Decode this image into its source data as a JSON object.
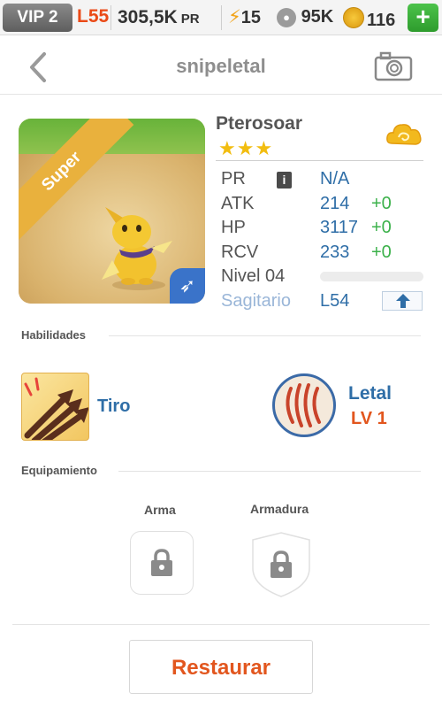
{
  "status_bar": {
    "vip": "VIP 2",
    "level": "L55",
    "power_value": "305,5K",
    "power_unit": "PR",
    "energy": "15",
    "paws": "95K",
    "coins": "116",
    "add": "+"
  },
  "header": {
    "title": "snipeletal"
  },
  "pet": {
    "rarity": "Super",
    "name": "Pterosoar",
    "stars": "★★★",
    "stats": {
      "pr_label": "PR",
      "pr_info": "i",
      "pr_value": "N/A",
      "atk_label": "ATK",
      "atk_value": "214",
      "atk_bonus": "+0",
      "hp_label": "HP",
      "hp_value": "3117",
      "hp_bonus": "+0",
      "rcv_label": "RCV",
      "rcv_value": "233",
      "rcv_bonus": "+0",
      "level_label": "Nivel 04",
      "xp_progress": 0,
      "class_label": "Sagitario",
      "class_level": "L54"
    }
  },
  "skills": {
    "section_title": "Habilidades",
    "skill1_name": "Tiro",
    "skill2_name": "Letal",
    "skill2_level": "LV 1"
  },
  "equipment": {
    "section_title": "Equipamiento",
    "weapon_label": "Arma",
    "armor_label": "Armadura"
  },
  "actions": {
    "restore_label": "Restaurar"
  },
  "colors": {
    "accent_blue": "#2f6ea7",
    "accent_orange": "#e2561e",
    "bonus_green": "#3bb14a",
    "star_gold": "#f2bd10"
  }
}
